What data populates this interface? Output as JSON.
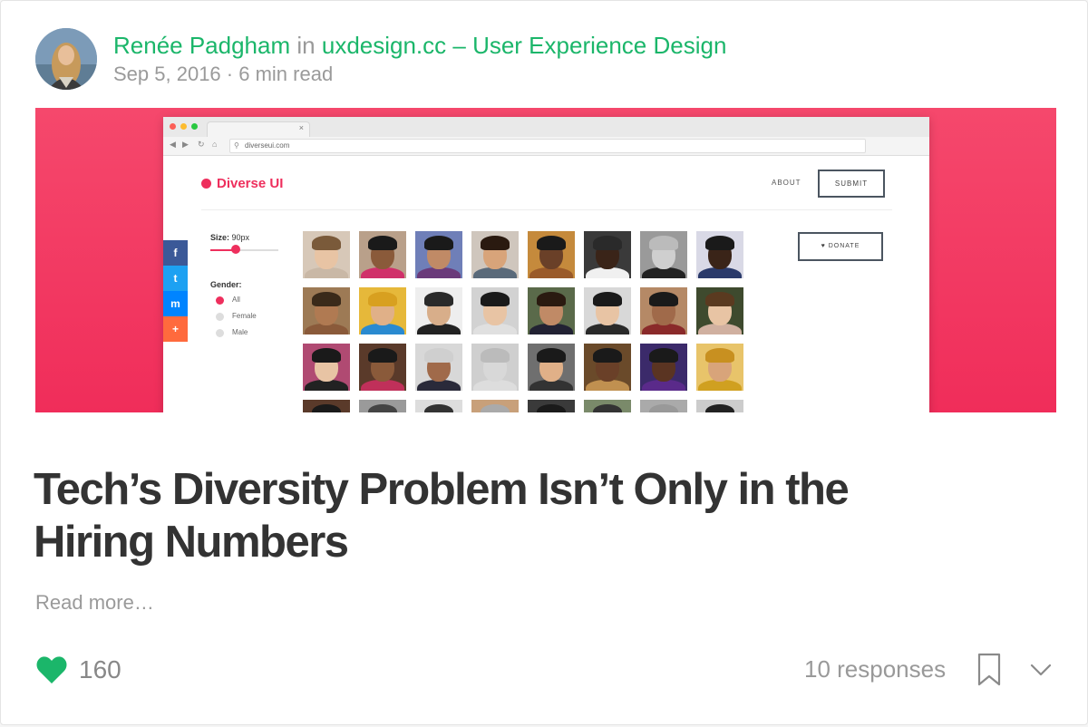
{
  "post": {
    "author": "Renée Padgham",
    "in_word": "in",
    "publication": "uxdesign.cc – User Experience Design",
    "date": "Sep 5, 2016",
    "separator": "·",
    "read_time": "6 min read",
    "title": "Tech’s Diversity Problem Isn’t Only in the Hiring Numbers",
    "read_more": "Read more…",
    "likes": "160",
    "responses": "10 responses"
  },
  "hero": {
    "url": "diverseui.com",
    "tab_close": "×",
    "brand": "Diverse UI",
    "nav_about": "ABOUT",
    "nav_submit": "SUBMIT",
    "size_label": "Size:",
    "size_value": "90px",
    "gender_label": "Gender:",
    "gender_options": [
      "All",
      "Female",
      "Male"
    ],
    "gender_selected": "All",
    "donate": "♥ DONATE",
    "share_icons": [
      "facebook-icon",
      "twitter-icon",
      "messenger-icon",
      "plus-icon"
    ],
    "share_glyphs": [
      "f",
      "t",
      "m",
      "+"
    ],
    "share_colors": [
      "#3b5998",
      "#1da1f2",
      "#0084ff",
      "#ff6a3d"
    ]
  },
  "colors": {
    "accent_green": "#1bb66a",
    "hero_pink": "#f23c63",
    "brand_pink": "#ee2f5d"
  }
}
